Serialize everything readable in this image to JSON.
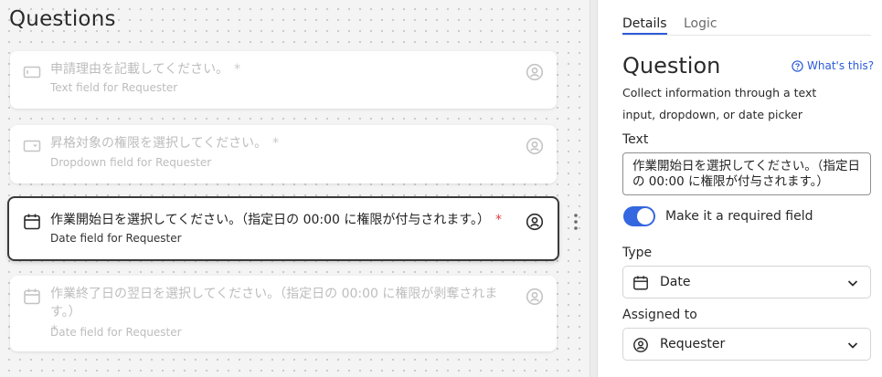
{
  "canvas": {
    "title": "Questions",
    "cards": [
      {
        "text": "申請理由を記載してください。",
        "required_mark": "*",
        "subtitle": "Text field for Requester",
        "icon": "text-field-icon",
        "state": "faded"
      },
      {
        "text": "昇格対象の権限を選択してください。",
        "required_mark": "*",
        "subtitle": "Dropdown field for Requester",
        "icon": "dropdown-field-icon",
        "state": "faded"
      },
      {
        "text": "作業開始日を選択してください。（指定日の 00:00 に権限が付与されます。）",
        "required_mark": "*",
        "subtitle": "Date field for Requester",
        "icon": "calendar-icon",
        "state": "selected"
      },
      {
        "text": "作業終了日の翌日を選択してください。（指定日の 00:00 に権限が剥奪されます。）",
        "required_mark": "*",
        "subtitle": "Date field for Requester",
        "icon": "calendar-icon",
        "state": "faded"
      }
    ]
  },
  "panel": {
    "tabs": [
      {
        "label": "Details",
        "active": true
      },
      {
        "label": "Logic",
        "active": false
      }
    ],
    "title": "Question",
    "whats_this": "What's this?",
    "description": "Collect information through a text input, dropdown, or date picker",
    "text_label": "Text",
    "text_value": "作業開始日を選択してください。（指定日の 00:00 に権限が付与されます。）",
    "required_toggle_label": "Make it a required field",
    "required": true,
    "type_label": "Type",
    "type_value": "Date",
    "assigned_label": "Assigned to",
    "assigned_value": "Requester"
  },
  "colors": {
    "accent": "#2b5bd9",
    "toggle": "#3467e0",
    "required_star": "#e03d3d"
  }
}
